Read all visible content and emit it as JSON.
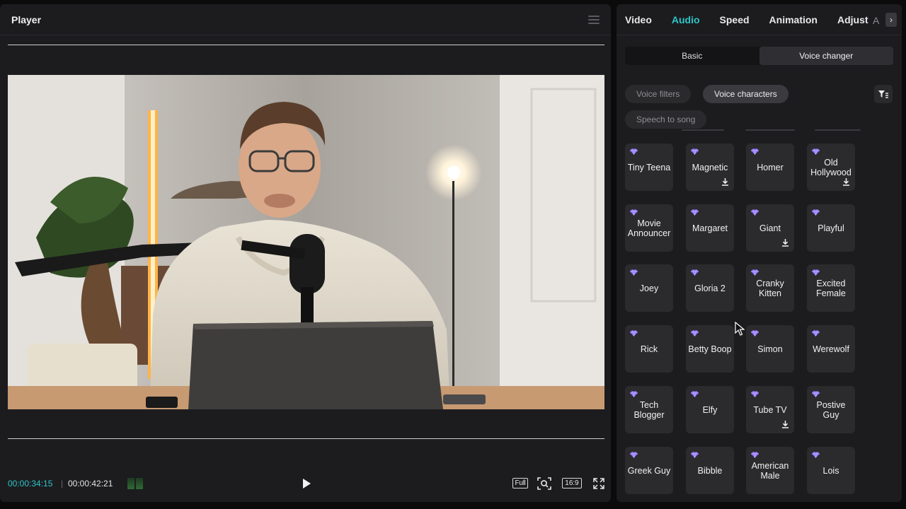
{
  "player": {
    "title": "Player",
    "current_time": "00:00:34:15",
    "separator": "|",
    "total_time": "00:00:42:21",
    "full_label": "Full",
    "ratio_label": "16:9"
  },
  "side": {
    "tabs": [
      "Video",
      "Audio",
      "Speed",
      "Animation",
      "Adjust"
    ],
    "active_tab": "Audio",
    "more_tab": "A",
    "segments": [
      "Basic",
      "Voice changer"
    ],
    "active_segment": "Voice changer",
    "chips": [
      "Voice filters",
      "Voice characters",
      "Speech to song"
    ],
    "active_chip": "Voice characters"
  },
  "voices": [
    {
      "name": "Tiny Teena",
      "download": false
    },
    {
      "name": "Magnetic",
      "download": true
    },
    {
      "name": "Homer",
      "download": false
    },
    {
      "name": "Old Hollywood",
      "download": true
    },
    {
      "name": "Movie Announcer",
      "download": false
    },
    {
      "name": "Margaret",
      "download": false
    },
    {
      "name": "Giant",
      "download": true
    },
    {
      "name": "Playful",
      "download": false
    },
    {
      "name": "Joey",
      "download": false
    },
    {
      "name": "Gloria 2",
      "download": false
    },
    {
      "name": "Cranky Kitten",
      "download": false
    },
    {
      "name": "Excited Female",
      "download": false
    },
    {
      "name": "Rick",
      "download": false
    },
    {
      "name": "Betty Boop",
      "download": false
    },
    {
      "name": "Simon",
      "download": false
    },
    {
      "name": "Werewolf",
      "download": false
    },
    {
      "name": "Tech Blogger",
      "download": false
    },
    {
      "name": "Elfy",
      "download": false
    },
    {
      "name": "Tube TV",
      "download": true
    },
    {
      "name": "Postive Guy",
      "download": false
    },
    {
      "name": "Greek Guy",
      "download": false
    },
    {
      "name": "Bibble",
      "download": false
    },
    {
      "name": "American Male",
      "download": false
    },
    {
      "name": "Lois",
      "download": false
    }
  ],
  "colors": {
    "accent": "#2ec5c8",
    "gem": "#8b6cff",
    "panel": "#1c1c1f",
    "card": "#2b2b2e"
  },
  "icons": {
    "menu": "menu-icon",
    "play": "play-icon",
    "zoom": "zoom-icon",
    "fullscreen": "fullscreen-icon",
    "filter": "filter-icon",
    "gem": "gem-icon",
    "download": "download-icon",
    "next": "chevron-right-icon"
  }
}
